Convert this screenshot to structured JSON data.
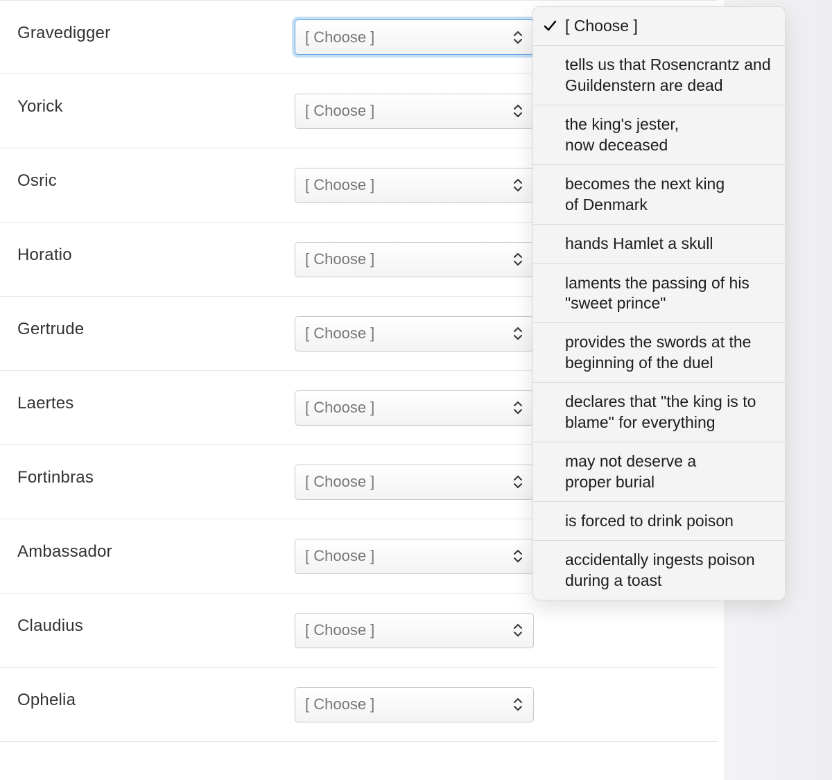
{
  "placeholder": "[ Choose ]",
  "rows": [
    {
      "label": "Gravedigger",
      "value": "[ Choose ]",
      "focused": true
    },
    {
      "label": "Yorick",
      "value": "[ Choose ]",
      "focused": false
    },
    {
      "label": "Osric",
      "value": "[ Choose ]",
      "focused": false
    },
    {
      "label": "Horatio",
      "value": "[ Choose ]",
      "focused": false
    },
    {
      "label": "Gertrude",
      "value": "[ Choose ]",
      "focused": false
    },
    {
      "label": "Laertes",
      "value": "[ Choose ]",
      "focused": false
    },
    {
      "label": "Fortinbras",
      "value": "[ Choose ]",
      "focused": false
    },
    {
      "label": "Ambassador",
      "value": "[ Choose ]",
      "focused": false
    },
    {
      "label": "Claudius",
      "value": "[ Choose ]",
      "focused": false
    },
    {
      "label": "Ophelia",
      "value": "[ Choose ]",
      "focused": false
    }
  ],
  "dropdown": {
    "selected_index": 0,
    "options": [
      "[ Choose ]",
      "tells us that Rosencrantz and Guildenstern are dead",
      "the king's jester, now deceased",
      "becomes the next king of Denmark",
      "hands Hamlet a skull",
      "laments the passing of his \"sweet prince\"",
      "provides the swords at the beginning of the duel",
      "declares that \"the king is to blame\" for everything",
      "may not deserve a proper burial",
      "is forced to drink poison",
      "accidentally ingests poison during a toast"
    ]
  }
}
